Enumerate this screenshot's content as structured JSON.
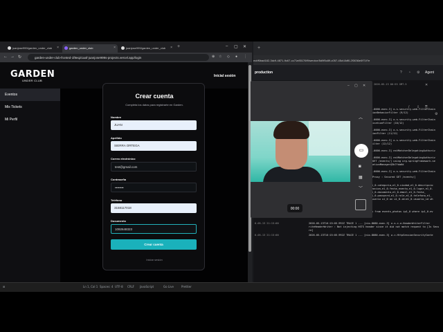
{
  "browser_left": {
    "tabs": [
      {
        "label": "juanjose999/garden_under_club"
      },
      {
        "label": "garden_under_club"
      },
      {
        "label": "juanjose999/garden_under_club"
      }
    ],
    "url": "garden-under-club-fronted-1f8eq21aaf-juanjose999s-projects.vercel.app/login"
  },
  "app": {
    "logo": "GARDEN",
    "logo_sub": "UNDER CLUB",
    "header_login": "Inicial sesión",
    "sidebar": [
      {
        "label": "Eventos"
      },
      {
        "label": "Mis Tickets"
      },
      {
        "label": "Mi Perfil"
      }
    ],
    "form": {
      "title": "Crear cuenta",
      "subtitle": "Completa los datos para registrarte en Garden.",
      "fields": [
        {
          "label": "Nombre",
          "value": "JUAN"
        },
        {
          "label": "Apellido",
          "value": "SIERRA ORTEGA"
        },
        {
          "label": "Correo electrónico",
          "value": "test@gmail.com"
        },
        {
          "label": "Contraseña",
          "value": "••••••••"
        },
        {
          "label": "Teléfono",
          "value": "3158117018"
        },
        {
          "label": "Documento",
          "value": "1092648323"
        }
      ],
      "submit": "Crear cuenta",
      "login_link": "Iniciar sesión"
    }
  },
  "browser_right": {
    "url": "ect/f6bad182-3dc9-4871-9c67-cc71e85176f9/service/5d9f5c89-c057-45cf-8df0-2f3036e0f71f?e",
    "project": "production",
    "agent": "Agent",
    "datetime": "2026-05-13 00:55 GMT-5",
    "logs": [
      {
        "ts": "",
        "text": "-0000-exec-3] o.s.security.web.FilterChain"
      },
      {
        "ts": "",
        "text": "ionBehaviorFilter (9/12)"
      },
      {
        "ts": "",
        "text": "-0000-exec-3] o.s.security.web.FilterChain"
      },
      {
        "ts": "",
        "text": "icationFilter (10/12)"
      },
      {
        "ts": "",
        "text": "-0000-exec-3] o.s.security.web.FilterChain"
      },
      {
        "ts": "",
        "text": "ionFilter (11/12)"
      },
      {
        "ts": "",
        "text": "-0000-exec-3] o.s.security.web.FilterChain"
      },
      {
        "ts": "",
        "text": "ilter (12/12)"
      },
      {
        "ts": "",
        "text": "-0000-exec-3] estMatcherDelegatingAuthoriz"
      },
      {
        "ts": "",
        "text": "-0000-exec-3] estMatcherDelegatingAuthoriz"
      },
      {
        "ts": "",
        "text": "GET /events/] using org.springframework.se"
      },
      {
        "ts": "",
        "text": "ationManager@3b7fda6d"
      },
      {
        "ts": "",
        "text": "-0000-exec-3] o.s.security.web.FilterChain"
      },
      {
        "ts": "",
        "text": "Proxy     : Secured GET /events/]"
      },
      {
        "ts": "6-05-13 21:15:00",
        "text": "Hibernate: select e1_0.id,e1_0.capacidad,e1_0.categoria,e1_0.ciudad,e1_0.descripcio"
      },
      {
        "ts": "",
        "text": "n,e1_0.direccion,e1_0.estado,e1_0.fecha_creacion,e1_0.fecha_evento,e1_0.lugar,e1_0."
      },
      {
        "ts": "",
        "text": "nombre,e1_0.id_e1_0.activo,e1_0.apellido,e1_0.documento,e1_0.email,e1_0.fecha_"
      },
      {
        "ts": "",
        "text": "creacion,e1_0.fecha_registro,e1_0.nombre,e1_0.password,e1_0.role,e1_0.telefono,e1_"
      },
      {
        "ts": "",
        "text": "0.precio_base from events e1_0 left join usuario u1_0 on u1_0.id=e1_0.usuario_id wh"
      },
      {
        "ts": "",
        "text": "ere e1_0.id=?"
      },
      {
        "ts": "6-05-13 21:15:00",
        "text": "Hibernate: select ip1_0.event_id,ip1_0.link from events_photos ip1_0 where ip1_0.ev"
      },
      {
        "ts": "",
        "text": "ent_id=?"
      },
      {
        "ts": "6-05-13 21:15:00",
        "text": "2026-05-13T16:15:05.992Z TRACE 1 --- [nio-8080-exec-3] o.s.c.a.HeaderWriterFilter"
      },
      {
        "ts": "",
        "text": "riteHeaderWriter : Not injecting HSTS header since it did not match request to [Is Secu"
      },
      {
        "ts": "",
        "text": "re]"
      },
      {
        "ts": "6-05-13 21:15:00",
        "text": "2026-05-13T16:15:05.992Z TRACE 1 --- [nio-8080-exec-3] w.c.HttpSessionSecurityConte"
      }
    ]
  },
  "camera": {
    "timer": "00:00"
  },
  "status_bar": {
    "items": [
      "Ln 1, Col 1",
      "Spaces: 4",
      "UTF-8",
      "CRLF",
      "JavaScript",
      "Go Live",
      "Prettier"
    ]
  },
  "colors": {
    "accent": "#1ab1bb",
    "input_fill": "#e8f0fb",
    "app_bg": "#0b0b0d"
  }
}
